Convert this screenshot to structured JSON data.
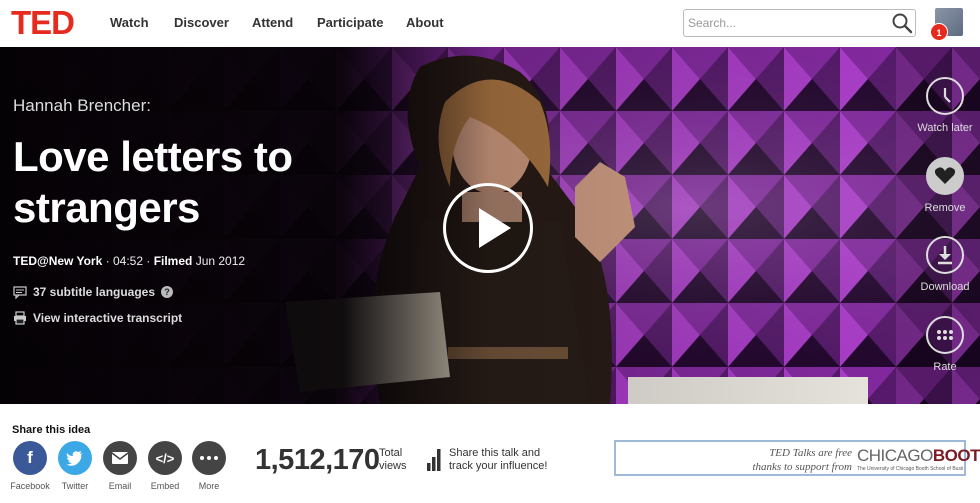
{
  "nav": {
    "logo": "TED",
    "links": [
      "Watch",
      "Discover",
      "Attend",
      "Participate",
      "About"
    ],
    "search_placeholder": "Search...",
    "notification_count": "1",
    "brand_color": "#e62b1e"
  },
  "talk": {
    "speaker": "Hannah Brencher:",
    "title": "Love letters to strangers",
    "event": "TED@New York",
    "duration": "04:52",
    "filmed_label": "Filmed",
    "filmed_date": "Jun 2012",
    "subtitles": "37 subtitle languages",
    "transcript": "View interactive transcript"
  },
  "actions": [
    {
      "label": "Watch later",
      "icon": "clock-icon"
    },
    {
      "label": "Remove",
      "icon": "heart-icon"
    },
    {
      "label": "Download",
      "icon": "download-icon"
    },
    {
      "label": "Rate",
      "icon": "more-dots-icon"
    }
  ],
  "share": {
    "heading": "Share this idea",
    "buttons": [
      {
        "label": "Facebook",
        "icon": "facebook-icon",
        "color": "#3b5998"
      },
      {
        "label": "Twitter",
        "icon": "twitter-icon",
        "color": "#3ca9e6"
      },
      {
        "label": "Email",
        "icon": "email-icon",
        "color": "#444444"
      },
      {
        "label": "Embed",
        "icon": "embed-icon",
        "color": "#444444"
      },
      {
        "label": "More",
        "icon": "more-icon",
        "color": "#444444"
      }
    ]
  },
  "stats": {
    "views": "1,512,170",
    "views_label": "Total views",
    "influence_line1": "Share this talk and",
    "influence_line2": "track your influence!"
  },
  "sponsor": {
    "line1": "TED Talks are free",
    "line2": "thanks to support from",
    "brand_city": "CHICAGO",
    "brand_name": "BOOTH",
    "brand_sub": "The University of Chicago Booth School of Business"
  }
}
